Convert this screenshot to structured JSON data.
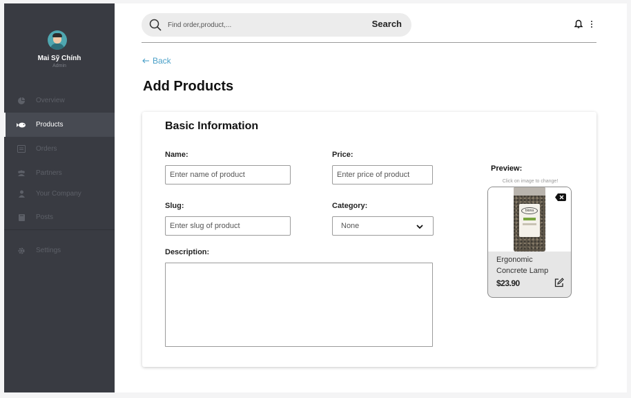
{
  "user": {
    "name": "Mai Sỹ Chính",
    "role": "Admin"
  },
  "nav": {
    "items": [
      {
        "label": "Overview",
        "icon": "pie-chart-icon"
      },
      {
        "label": "Products",
        "icon": "fish-icon"
      },
      {
        "label": "Orders",
        "icon": "receipt-icon"
      },
      {
        "label": "Partners",
        "icon": "group-icon"
      },
      {
        "label": "Your Company",
        "icon": "person-icon"
      },
      {
        "label": "Posts",
        "icon": "book-icon"
      }
    ],
    "settings": {
      "label": "Settings",
      "icon": "gear-icon"
    },
    "active": "Products"
  },
  "search": {
    "placeholder": "Find order,product,...",
    "button_label": "Search"
  },
  "header": {
    "icons": [
      "bell-icon",
      "kebab-menu-icon"
    ]
  },
  "back": {
    "label": "Back"
  },
  "page": {
    "title": "Add Products"
  },
  "form": {
    "section_title": "Basic Information",
    "name": {
      "label": "Name:",
      "placeholder": "Enter name of product"
    },
    "price": {
      "label": "Price:",
      "placeholder": "Enter price of product"
    },
    "slug": {
      "label": "Slug:",
      "placeholder": "Enter slug of product"
    },
    "category": {
      "label": "Category:",
      "selected": "None"
    },
    "description": {
      "label": "Description:"
    }
  },
  "preview": {
    "label": "Preview:",
    "hint": "Click on image to change!",
    "product_name": "Ergonomic Concrete Lamp",
    "price": "$23.90",
    "image_brand": "biona"
  },
  "colors": {
    "sidebar": "#393b42",
    "sidebar_active": "#474a52",
    "accent": "#4aa0c8"
  }
}
